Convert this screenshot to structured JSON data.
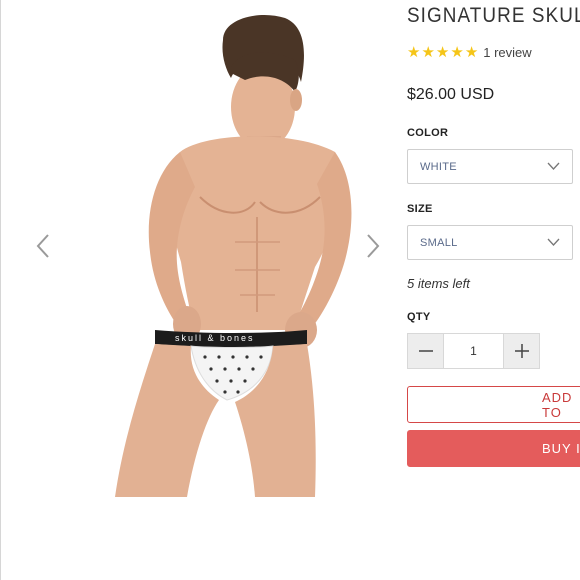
{
  "product": {
    "title": "SIGNATURE SKULL P",
    "rating_stars": 5,
    "review_count": "1 review",
    "price": "$26.00 USD",
    "waistband_text": "skull & bones"
  },
  "options": {
    "color_label": "COLOR",
    "color_value": "WHITE",
    "size_label": "SIZE",
    "size_value": "SMALL"
  },
  "stock_text": "5 items left",
  "quantity": {
    "label": "QTY",
    "value": "1"
  },
  "buttons": {
    "add_to_cart": "ADD TO",
    "buy_now": "BUY IT"
  },
  "colors": {
    "accent": "#e45c5c",
    "star": "#f5c518"
  }
}
